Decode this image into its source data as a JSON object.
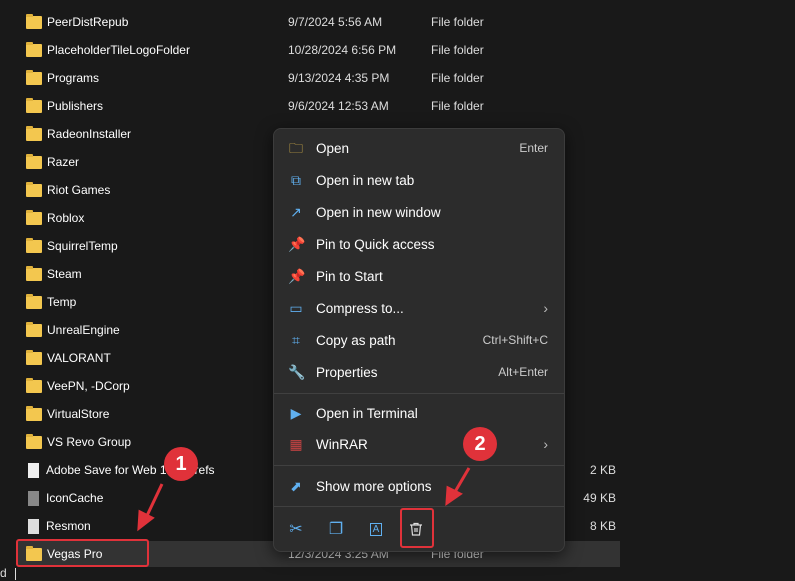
{
  "files": [
    {
      "name": "PeerDistRepub",
      "date": "9/7/2024 5:56 AM",
      "type": "File folder",
      "size": "",
      "icon": "folder-icon"
    },
    {
      "name": "PlaceholderTileLogoFolder",
      "date": "10/28/2024 6:56 PM",
      "type": "File folder",
      "size": "",
      "icon": "folder-icon"
    },
    {
      "name": "Programs",
      "date": "9/13/2024 4:35 PM",
      "type": "File folder",
      "size": "",
      "icon": "folder-icon"
    },
    {
      "name": "Publishers",
      "date": "9/6/2024 12:53 AM",
      "type": "File folder",
      "size": "",
      "icon": "folder-icon"
    },
    {
      "name": "RadeonInstaller",
      "date": "",
      "type": "",
      "size": "",
      "icon": "folder-icon"
    },
    {
      "name": "Razer",
      "date": "",
      "type": "",
      "size": "",
      "icon": "folder-icon"
    },
    {
      "name": "Riot Games",
      "date": "",
      "type": "",
      "size": "",
      "icon": "folder-icon"
    },
    {
      "name": "Roblox",
      "date": "",
      "type": "",
      "size": "",
      "icon": "folder-icon"
    },
    {
      "name": "SquirrelTemp",
      "date": "",
      "type": "",
      "size": "",
      "icon": "folder-icon"
    },
    {
      "name": "Steam",
      "date": "",
      "type": "",
      "size": "",
      "icon": "folder-icon"
    },
    {
      "name": "Temp",
      "date": "",
      "type": "",
      "size": "",
      "icon": "folder-icon"
    },
    {
      "name": "UnrealEngine",
      "date": "",
      "type": "",
      "size": "",
      "icon": "folder-icon"
    },
    {
      "name": "VALORANT",
      "date": "",
      "type": "",
      "size": "",
      "icon": "folder-icon"
    },
    {
      "name": "VeePN, -DCorp",
      "date": "",
      "type": "",
      "size": "",
      "icon": "folder-icon"
    },
    {
      "name": "VirtualStore",
      "date": "",
      "type": "",
      "size": "",
      "icon": "folder-icon"
    },
    {
      "name": "VS Revo Group",
      "date": "",
      "type": "",
      "size": "",
      "icon": "folder-icon"
    },
    {
      "name": "Adobe Save for Web 13.0 Prefs",
      "date": "",
      "type": "",
      "size": "2 KB",
      "icon": "file-icon"
    },
    {
      "name": "IconCache",
      "date": "",
      "type": "",
      "size": "49 KB",
      "icon": "file-gear-icon"
    },
    {
      "name": "Resmon",
      "date": "",
      "type": "",
      "size": "8 KB",
      "icon": "file-res-icon"
    },
    {
      "name": "Vegas Pro",
      "date": "12/3/2024 3:25 AM",
      "type": "File folder",
      "size": "",
      "icon": "folder-icon"
    }
  ],
  "menu": {
    "items": [
      {
        "label": "Open",
        "shortcut": "Enter",
        "icon": "open-folder-icon"
      },
      {
        "label": "Open in new tab",
        "shortcut": "",
        "icon": "new-tab-icon"
      },
      {
        "label": "Open in new window",
        "shortcut": "",
        "icon": "new-window-icon"
      },
      {
        "label": "Pin to Quick access",
        "shortcut": "",
        "icon": "pin-icon"
      },
      {
        "label": "Pin to Start",
        "shortcut": "",
        "icon": "pin-icon"
      },
      {
        "label": "Compress to...",
        "shortcut": "",
        "icon": "zip-icon"
      },
      {
        "label": "Copy as path",
        "shortcut": "Ctrl+Shift+C",
        "icon": "path-icon"
      },
      {
        "label": "Properties",
        "shortcut": "Alt+Enter",
        "icon": "wrench-icon"
      },
      {
        "label": "Open in Terminal",
        "shortcut": "",
        "icon": "terminal-icon"
      },
      {
        "label": "WinRAR",
        "shortcut": "",
        "icon": "winrar-icon"
      },
      {
        "label": "Show more options",
        "shortcut": "",
        "icon": "show-more-icon"
      }
    ]
  },
  "badges": [
    "1",
    "2"
  ],
  "status": "d"
}
